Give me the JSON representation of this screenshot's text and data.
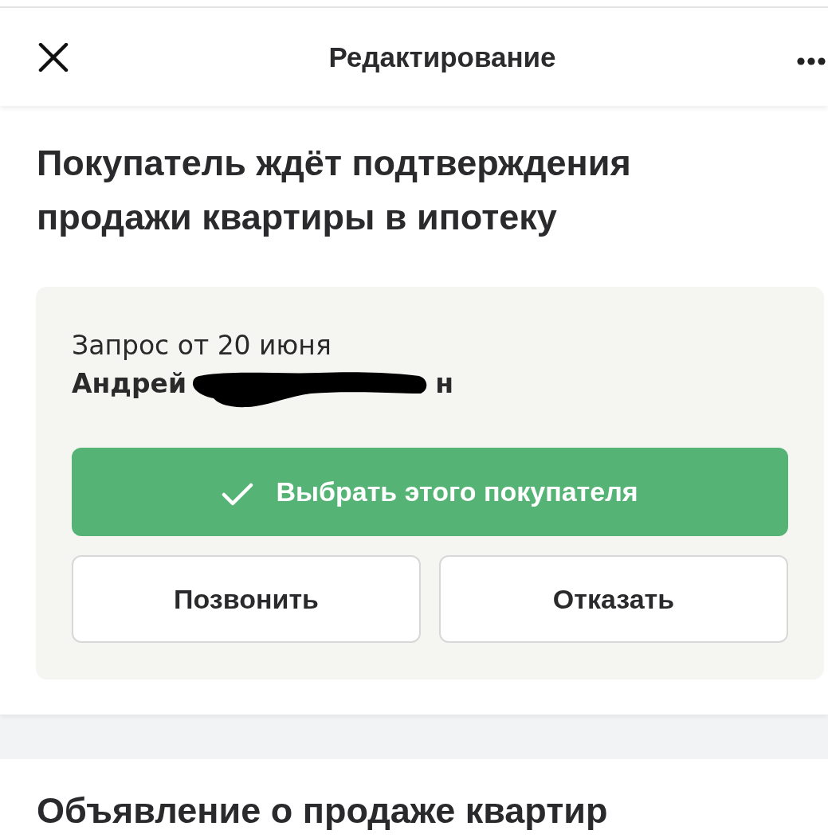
{
  "header": {
    "title": "Редактирование"
  },
  "request_section": {
    "heading": "Покупатель ждёт подтверждения продажи квартиры в ипотеку",
    "request_card": {
      "date_text": "Запрос от 20 июня",
      "buyer_name": {
        "visible_parts": [
          "Андрей",
          "н"
        ],
        "redacted": true
      },
      "buttons": [
        {
          "kind": "primary",
          "label": "Выбрать этого покупателя"
        },
        {
          "kind": "secondary",
          "label": "Позвонить"
        },
        {
          "kind": "secondary",
          "label": "Отказать"
        }
      ]
    }
  },
  "listing_section": {
    "heading": "Объявление о продаже квартир"
  }
}
